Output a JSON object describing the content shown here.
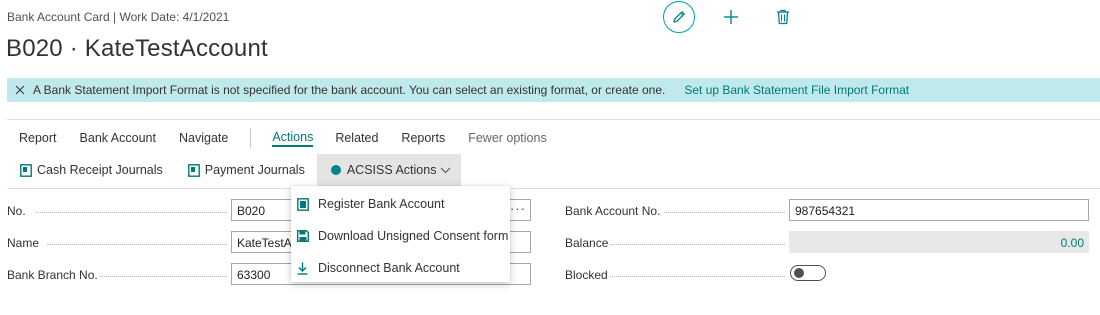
{
  "header": {
    "breadcrumb": "Bank Account Card | Work Date: 4/1/2021",
    "title": "B020 · KateTestAccount",
    "edit_icon": "pencil-icon",
    "add_icon": "plus-icon",
    "delete_icon": "trash-icon"
  },
  "banner": {
    "close_icon": "close-icon",
    "message": "A Bank Statement Import Format is not specified for the bank account. You can select an existing format, or create one.",
    "link": "Set up Bank Statement File Import Format"
  },
  "menu": {
    "items": [
      "Report",
      "Bank Account",
      "Navigate",
      "Actions",
      "Related",
      "Reports",
      "Fewer options"
    ],
    "active": "Actions"
  },
  "actions": {
    "cash_receipt": "Cash Receipt Journals",
    "payment": "Payment Journals",
    "acsiss": "ACSISS Actions"
  },
  "dropdown": {
    "items": [
      {
        "label": "Register Bank Account",
        "icon": "register-icon"
      },
      {
        "label": "Download Unsigned Consent form",
        "icon": "save-icon"
      },
      {
        "label": "Disconnect Bank Account",
        "icon": "download-icon"
      }
    ]
  },
  "fields": {
    "no": {
      "label": "No.",
      "value": "B020"
    },
    "name": {
      "label": "Name",
      "value": "KateTestAccount"
    },
    "branch": {
      "label": "Bank Branch No.",
      "value": "63300"
    },
    "account_no": {
      "label": "Bank Account No.",
      "value": "987654321"
    },
    "balance": {
      "label": "Balance",
      "value": "0.00"
    },
    "blocked": {
      "label": "Blocked",
      "value": false
    }
  },
  "colors": {
    "accent": "#00797a",
    "banner_bg": "#bfe9ea",
    "action_dot": "#00878a"
  }
}
